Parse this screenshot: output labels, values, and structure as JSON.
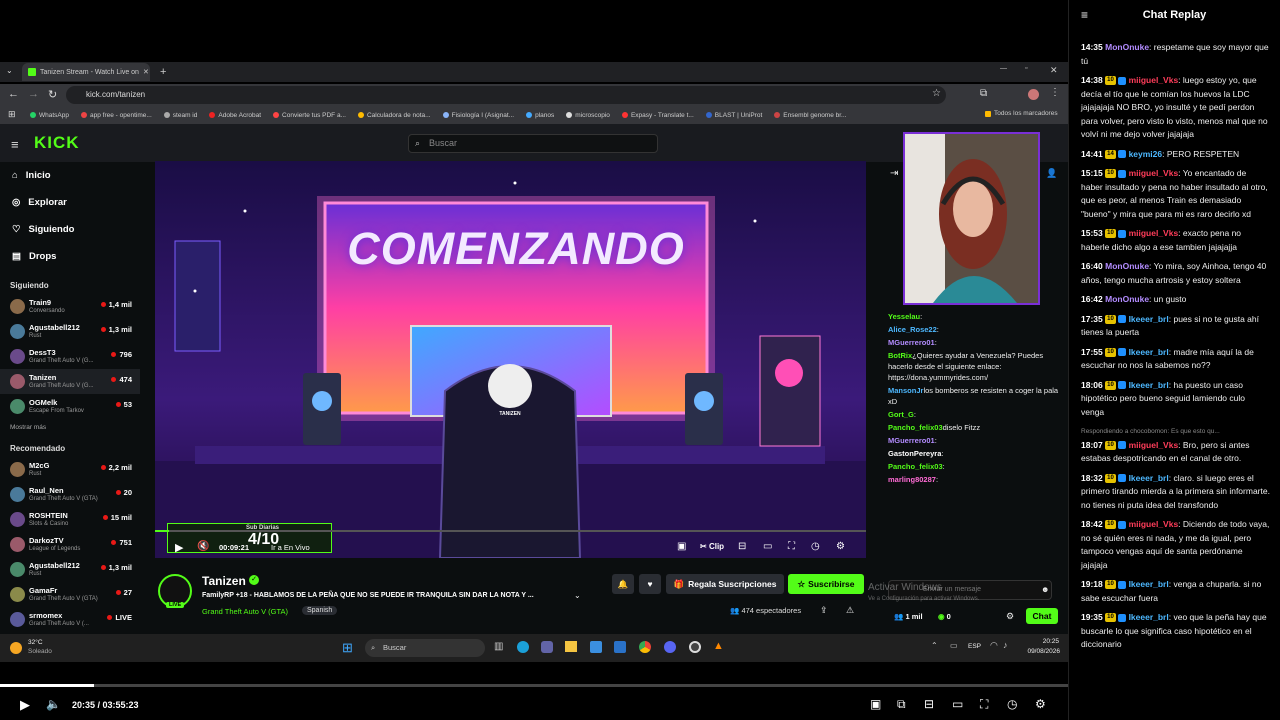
{
  "browser": {
    "tab_title": "Tanizen Stream - Watch Live on",
    "new_tab": "+",
    "url": "kick.com/tanizen",
    "bookmarks": [
      "WhatsApp",
      "app free - opentime...",
      "steam id",
      "Adobe Acrobat",
      "Convierte tus PDF a...",
      "Calculadora de nota...",
      "Fisiología I (Asignat...",
      "planos",
      "microscopio",
      "Expasy - Translate t...",
      "BLAST | UniProt",
      "Ensembl genome br..."
    ],
    "bookmarks_all": "Todos los marcadores"
  },
  "kick": {
    "logo": "KICK",
    "search_placeholder": "Buscar",
    "nav": [
      {
        "label": "Inicio",
        "icon": "home-icon"
      },
      {
        "label": "Explorar",
        "icon": "compass-icon"
      },
      {
        "label": "Siguiendo",
        "icon": "heart-icon"
      },
      {
        "label": "Drops",
        "icon": "drops-icon"
      }
    ],
    "following_title": "Siguiendo",
    "following": [
      {
        "name": "Train9",
        "game": "Conversando",
        "viewers": "1,4 mil"
      },
      {
        "name": "Agustabell212",
        "game": "Rust",
        "viewers": "1,3 mil"
      },
      {
        "name": "DessT3",
        "game": "Grand Theft Auto V (G...",
        "viewers": "796"
      },
      {
        "name": "Tanizen",
        "game": "Grand Theft Auto V (G...",
        "viewers": "474"
      },
      {
        "name": "OGMelk",
        "game": "Escape From Tarkov",
        "viewers": "53"
      }
    ],
    "show_more": "Mostrar más",
    "recommended_title": "Recomendado",
    "recommended": [
      {
        "name": "M2cG",
        "game": "Rust",
        "viewers": "2,2 mil"
      },
      {
        "name": "Raul_Nen",
        "game": "Grand Theft Auto V (GTA)",
        "viewers": "20"
      },
      {
        "name": "ROSHTEIN",
        "game": "Slots & Casino",
        "viewers": "15 mil"
      },
      {
        "name": "DarkozTV",
        "game": "League of Legends",
        "viewers": "751"
      },
      {
        "name": "Agustabell212",
        "game": "Rust",
        "viewers": "1,3 mil"
      },
      {
        "name": "GamaFr",
        "game": "Grand Theft Auto V (GTA)",
        "viewers": "27"
      },
      {
        "name": "srmomex",
        "game": "Grand Theft Auto V (...",
        "viewers": "LIVE"
      }
    ],
    "video": {
      "title_art": "COMENZANDO",
      "chair_text": "TANIZEN",
      "sub_goal_label": "Sub Diarias",
      "sub_goal_value": "4/10",
      "time": "00:09:21",
      "live_link": "Ir a En Vivo",
      "clip": "Clip",
      "progress": 0.02
    },
    "stream": {
      "channel": "Tanizen",
      "live_badge": "LIVE",
      "title": "FamilyRP +18 - HABLAMOS DE LA PEÑA QUE NO SE PUEDE IR TRANQUILA SIN DAR LA NOTA Y ...",
      "category": "Grand Theft Auto V (GTA)",
      "tag": "Spanish",
      "gift_button": "Regala Suscripciones",
      "subscribe_button": "Suscribirse",
      "viewers": "474 espectadores"
    },
    "chat": {
      "messages": [
        {
          "user": "Yesselau",
          "text": ":",
          "color": "#53fc18"
        },
        {
          "user": "Alice_Rose22",
          "text": ":",
          "color": "#4db8ff"
        },
        {
          "user": "MGuerrero01",
          "text": ":",
          "color": "#b38cff"
        },
        {
          "user": "BotRix",
          "text": "¿Quieres ayudar a Venezuela? Puedes hacerlo desde el siguiente enlace: https://dona.yummyrides.com/",
          "color": "#53fc18"
        },
        {
          "user": "MansonJr",
          "text": "los bomberos se resisten a coger la pala xD",
          "color": "#4db8ff"
        },
        {
          "user": "Gort_G",
          "text": ":",
          "color": "#53fc18"
        },
        {
          "user": "Pancho_felix03",
          "text": "diselo Fitzz",
          "color": "#53fc18"
        },
        {
          "user": "MGuerrero01",
          "text": ":",
          "color": "#b38cff"
        },
        {
          "user": "GastonPereyra",
          "text": ":",
          "color": "#fff"
        },
        {
          "user": "Pancho_felix03",
          "text": ":",
          "color": "#53fc18"
        },
        {
          "user": "marling80287",
          "text": ":",
          "color": "#ff6bd5"
        }
      ],
      "input_placeholder": "Enviar un mensaje",
      "windows_watermark": "Activar Windows",
      "windows_watermark_sub": "Ve a Configuración para activar Windows.",
      "likes": "1 mil",
      "points": "0",
      "chat_button": "Chat"
    }
  },
  "taskbar": {
    "weather_temp": "32°C",
    "weather_text": "Soleado",
    "search": "Buscar",
    "lang": "ESP",
    "time": "20:25",
    "date": "09/08/2026"
  },
  "player": {
    "time": "20:35 / 03:55:23",
    "progress": 0.088
  },
  "replay": {
    "title": "Chat Replay",
    "messages": [
      {
        "t": "14:35",
        "user": "MonOnuke",
        "color": "#b38cff",
        "badge": "",
        "text": "respetame que soy mayor que tú"
      },
      {
        "t": "14:38",
        "user": "miiguel_Vks",
        "color": "#ff3d5a",
        "badge": "10",
        "text": "luego estoy yo, que decía el tío que le comían los huevos la LDC jajajajaja NO BRO, yo insulté y te pedí perdon para volver, pero visto lo visto, menos mal que no volví ni me dejo volver jajajaja"
      },
      {
        "t": "14:41",
        "user": "keymi26",
        "color": "#4db8ff",
        "badge": "14",
        "text": "PERO RESPETEN"
      },
      {
        "t": "15:15",
        "user": "miiguel_Vks",
        "color": "#ff3d5a",
        "badge": "10",
        "text": "Yo encantado de haber insultado y pena no haber insultado al otro, que es peor, al menos Train es demasiado \"bueno\" y mira que para mi es raro decirlo xd"
      },
      {
        "t": "15:53",
        "user": "miiguel_Vks",
        "color": "#ff3d5a",
        "badge": "10",
        "text": "exacto pena no haberle dicho algo a ese tambien jajajajja"
      },
      {
        "t": "16:40",
        "user": "MonOnuke",
        "color": "#b38cff",
        "badge": "",
        "text": "Yo mira, soy Ainhoa, tengo 40 años, tengo mucha artrosis y estoy soltera"
      },
      {
        "t": "16:42",
        "user": "MonOnuke",
        "color": "#b38cff",
        "badge": "",
        "text": "un gusto"
      },
      {
        "t": "17:35",
        "user": "Ikeeer_brl",
        "color": "#4db8ff",
        "badge": "10",
        "text": "pues si no te gusta ahí tienes la puerta"
      },
      {
        "t": "17:55",
        "user": "Ikeeer_brl",
        "color": "#4db8ff",
        "badge": "10",
        "text": "madre mía aquí la de escuchar no nos la sabemos no??"
      },
      {
        "t": "18:06",
        "user": "Ikeeer_brl",
        "color": "#4db8ff",
        "badge": "10",
        "text": "ha puesto un caso hipotético pero bueno seguid lamiendo culo venga"
      },
      {
        "t": "18:07",
        "user": "miiguel_Vks",
        "color": "#ff3d5a",
        "badge": "10",
        "reply": "Respondiendo a chocobomon: Es que esto qu...",
        "text": "Bro, pero si antes estabas despotricando en el canal de otro."
      },
      {
        "t": "18:32",
        "user": "Ikeeer_brl",
        "color": "#4db8ff",
        "badge": "10",
        "text": "claro. si luego eres el primero tirando mierda a la primera sin informarte. no tienes ni puta idea del transfondo"
      },
      {
        "t": "18:42",
        "user": "miiguel_Vks",
        "color": "#ff3d5a",
        "badge": "10",
        "text": "Diciendo de todo vaya, no sé quién eres ni nada, y me da igual, pero tampoco vengas aquí de santa perdóname jajajaja"
      },
      {
        "t": "19:18",
        "user": "Ikeeer_brl",
        "color": "#4db8ff",
        "badge": "10",
        "text": "venga a chuparla. si no sabe escuchar fuera"
      },
      {
        "t": "19:35",
        "user": "Ikeeer_brl",
        "color": "#4db8ff",
        "badge": "10",
        "text": "veo que la peña hay que buscarle lo que significa caso hipotético en el diccionario"
      }
    ]
  }
}
